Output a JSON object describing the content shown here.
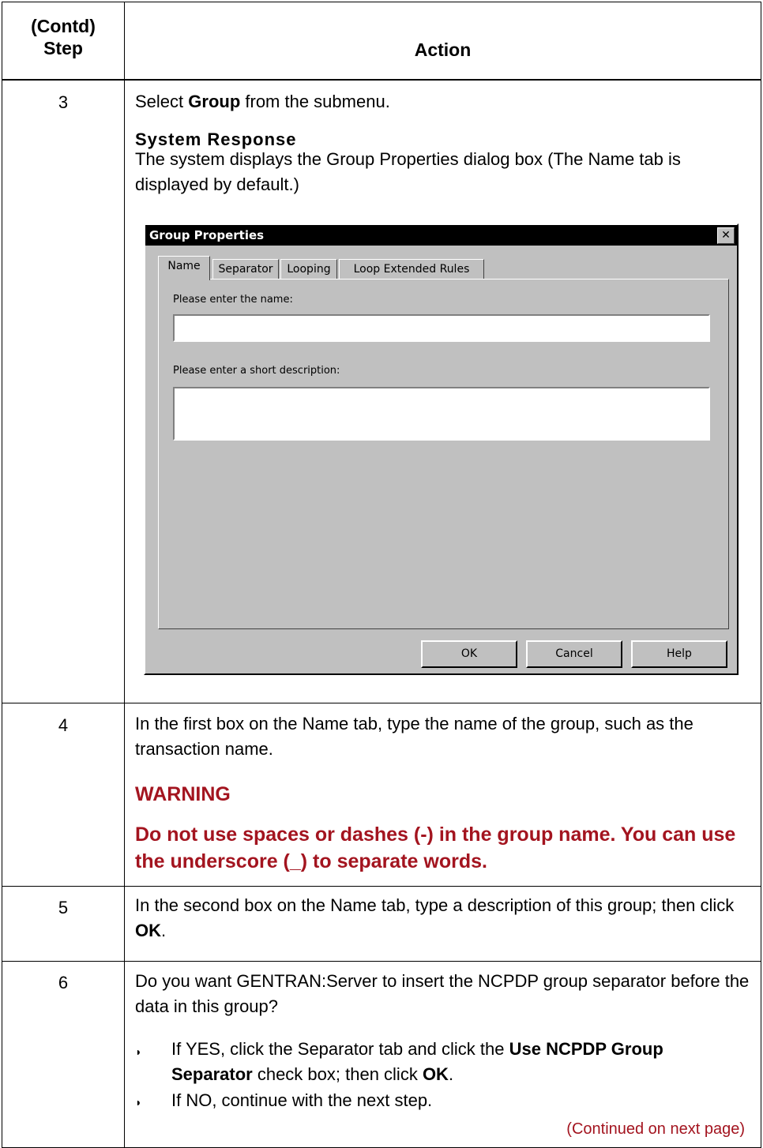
{
  "header": {
    "step_label_1": "(Contd)",
    "step_label_2": "Step",
    "action_label": "Action"
  },
  "rows": [
    {
      "step": "3"
    },
    {
      "step": "4"
    },
    {
      "step": "5"
    },
    {
      "step": "6"
    }
  ],
  "step3": {
    "text_prefix": "Select ",
    "text_bold": "Group",
    "text_suffix": " from the submenu.",
    "system_response_heading": "System Response",
    "system_response_text": "The system displays the Group Properties dialog box (The Name tab is displayed by default.)"
  },
  "dialog": {
    "title": "Group Properties",
    "close_glyph": "✕",
    "tabs": [
      "Name",
      "Separator",
      "Looping",
      "Loop Extended Rules"
    ],
    "name_label": "Please enter the name:",
    "name_value": "",
    "description_label": "Please enter a short description:",
    "description_value": "",
    "buttons": {
      "ok": "OK",
      "cancel": "Cancel",
      "help": "Help"
    }
  },
  "step4": {
    "text": "In the first box on the Name tab, type the name of the group, such as the transaction name.",
    "warning_heading": "WARNING",
    "warning_text": "Do not use spaces or dashes (-) in the group name. You can use the underscore (_) to separate words."
  },
  "step5": {
    "text_prefix": "In the second box on the Name tab, type a description of this group; then click ",
    "text_bold": "OK",
    "text_suffix": "."
  },
  "step6": {
    "question": "Do you want GENTRAN:Server to insert the NCPDP group separator before the data in this group?",
    "bullet1_prefix": "If YES, click the Separator tab and click the ",
    "bullet1_bold": "Use NCPDP Group Separator",
    "bullet1_mid": " check box; then click ",
    "bullet1_bold2": "OK",
    "bullet1_suffix": ".",
    "bullet2": "If NO, continue with the next step.",
    "continued": "(Continued on next page)"
  }
}
